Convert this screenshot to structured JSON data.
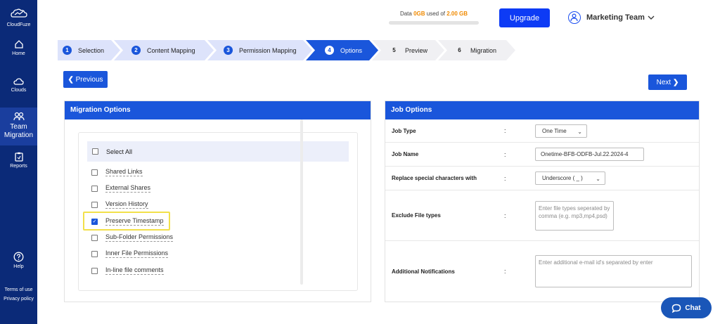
{
  "brand": {
    "name": "CloudFuze"
  },
  "nav": {
    "home": "Home",
    "clouds": "Clouds",
    "team_migration": "Team Migration",
    "reports": "Reports",
    "help": "Help",
    "terms": "Terms of use",
    "privacy": "Privacy policy"
  },
  "header": {
    "usage_prefix": "Data",
    "usage_used": "0GB",
    "usage_mid": "used of",
    "usage_total": "2.00 GB",
    "usage_fraction": 0,
    "upgrade_label": "Upgrade",
    "user_name": "Marketing Team"
  },
  "steps": [
    {
      "num": "1",
      "label": "Selection",
      "state": "done"
    },
    {
      "num": "2",
      "label": "Content Mapping",
      "state": "done"
    },
    {
      "num": "3",
      "label": "Permission Mapping",
      "state": "done"
    },
    {
      "num": "4",
      "label": "Options",
      "state": "active"
    },
    {
      "num": "5",
      "label": "Preview",
      "state": "future"
    },
    {
      "num": "6",
      "label": "Migration",
      "state": "future"
    }
  ],
  "buttons": {
    "previous": "Previous",
    "next": "Next"
  },
  "migration_options": {
    "title": "Migration Options",
    "select_all": "Select All",
    "items": [
      {
        "label": "Shared Links",
        "checked": false
      },
      {
        "label": "External Shares",
        "checked": false
      },
      {
        "label": "Version History",
        "checked": false
      },
      {
        "label": "Preserve Timestamp",
        "checked": true
      },
      {
        "label": "Sub-Folder Permissions",
        "checked": false
      },
      {
        "label": "Inner File Permissions",
        "checked": false
      },
      {
        "label": "In-line file comments",
        "checked": false
      }
    ]
  },
  "job_options": {
    "title": "Job Options",
    "job_type_label": "Job Type",
    "job_type_value": "One Time",
    "job_name_label": "Job Name",
    "job_name_value": "Onetime-BFB-ODFB-Jul.22.2024-4",
    "replace_label": "Replace special characters with",
    "replace_value": "Underscore ( _ )",
    "exclude_label": "Exclude File types",
    "exclude_placeholder": "Enter file types seperated by comma (e.g. mp3,mp4,psd)",
    "notify_label": "Additional Notifications",
    "notify_placeholder": "Enter additional e-mail id's separated by enter",
    "colon": ":"
  },
  "chat": {
    "label": "Chat"
  },
  "colors": {
    "sidebar": "#0b2a78",
    "primary": "#1a56db",
    "upgrade": "#0d3bf5",
    "highlight": "#f2e04a",
    "usage_accent": "#f08a00"
  }
}
